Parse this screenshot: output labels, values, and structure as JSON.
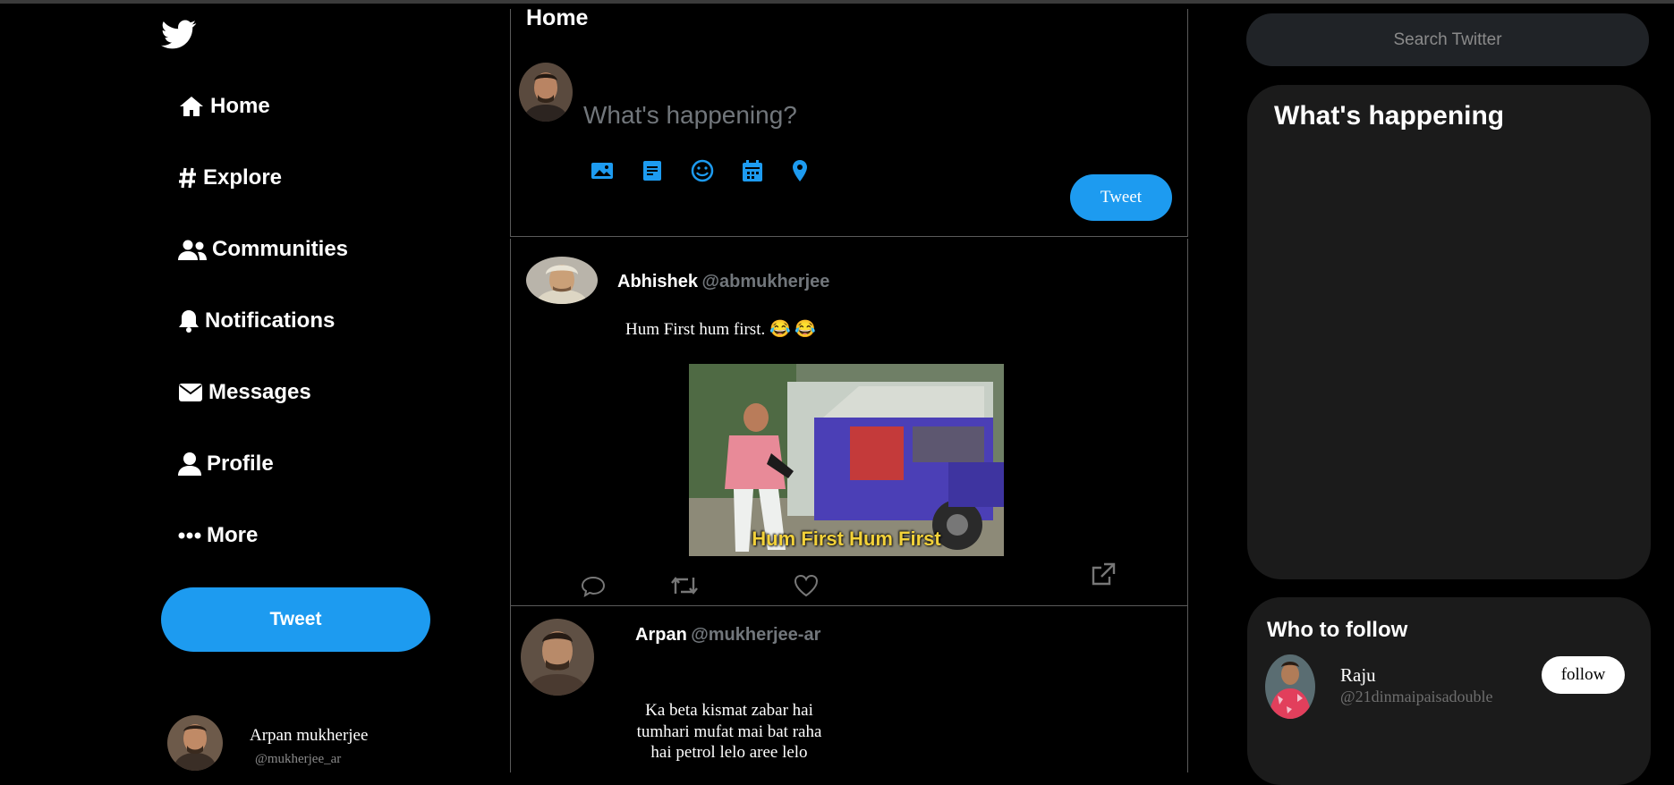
{
  "colors": {
    "accent": "#1d9bf0",
    "background": "#000000",
    "panel": "#1b1b1b",
    "muted": "#71767b"
  },
  "nav": {
    "logo_icon": "twitter-bird-icon",
    "items": [
      {
        "label": "Home",
        "icon": "home-icon"
      },
      {
        "label": "Explore",
        "icon": "hashtag-icon"
      },
      {
        "label": "Communities",
        "icon": "users-icon"
      },
      {
        "label": "Notifications",
        "icon": "bell-icon"
      },
      {
        "label": "Messages",
        "icon": "envelope-icon"
      },
      {
        "label": "Profile",
        "icon": "user-icon"
      },
      {
        "label": "More",
        "icon": "ellipsis-icon"
      }
    ],
    "tweet_label": "Tweet"
  },
  "account": {
    "name": "Arpan mukherjee",
    "handle": "@mukherjee_ar"
  },
  "composer": {
    "title": "Home",
    "placeholder": "What's happening?",
    "tools": [
      "image-icon",
      "gif-icon",
      "emoji-icon",
      "schedule-icon",
      "location-icon"
    ],
    "tweet_label": "Tweet"
  },
  "feed": [
    {
      "name": "Abhishek",
      "handle": "@abmukherjee",
      "text": "Hum First hum first. 😂 😂",
      "media_caption": "Hum First Hum First",
      "actions": [
        "reply-icon",
        "retweet-icon",
        "like-icon",
        "share-icon"
      ]
    },
    {
      "name": "Arpan",
      "handle": "@mukherjee-ar",
      "text": "Ka beta kismat zabar hai tumhari mufat mai bat raha hai petrol lelo aree lelo"
    }
  ],
  "search": {
    "placeholder": "Search Twitter"
  },
  "trends": {
    "title": "What's happening"
  },
  "who_to_follow": {
    "title": "Who to follow",
    "users": [
      {
        "name": "Raju",
        "handle": "@21dinmaipaisadouble",
        "button": "follow"
      }
    ]
  }
}
